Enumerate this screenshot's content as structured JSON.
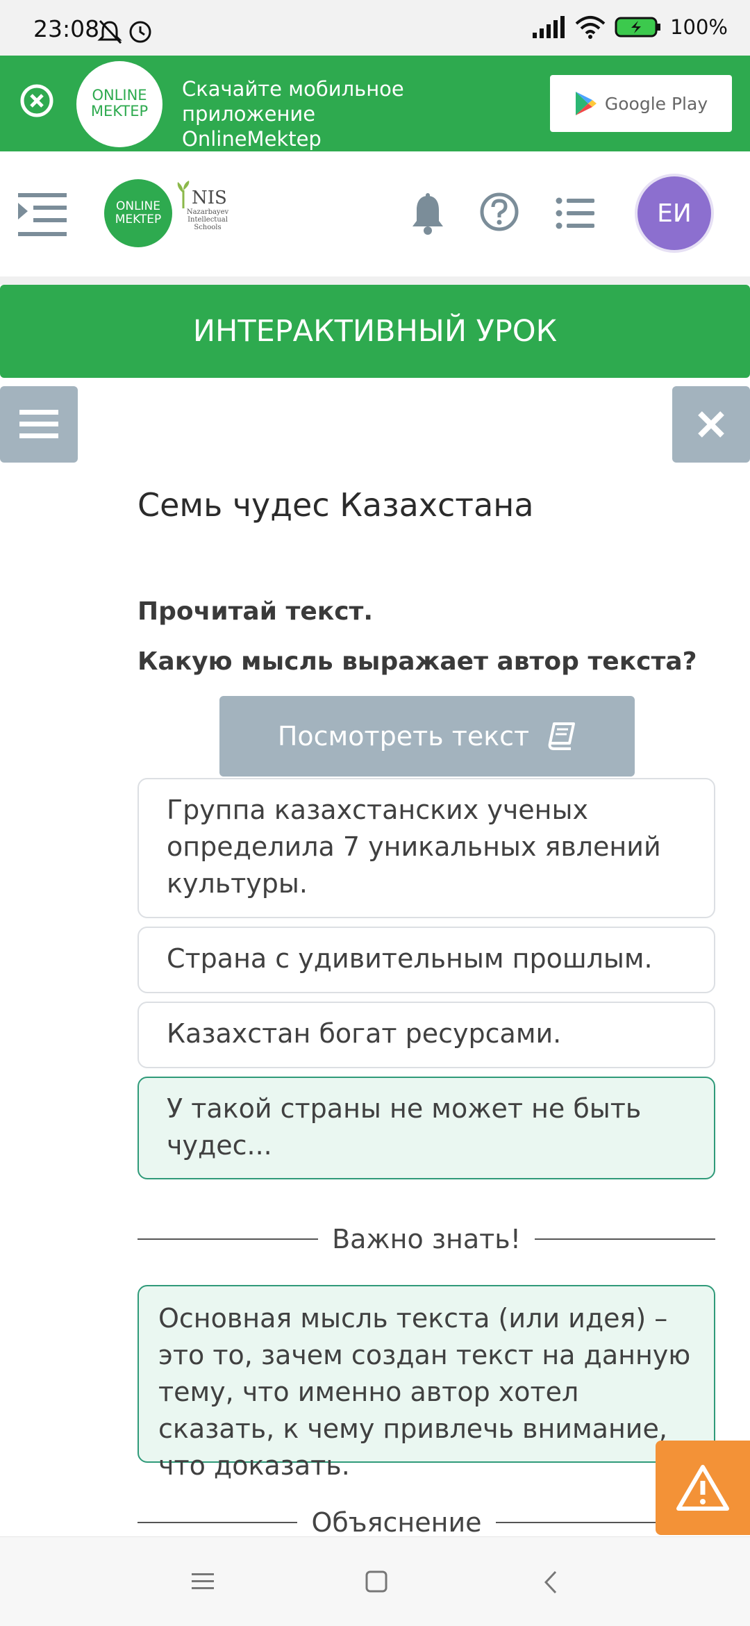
{
  "status": {
    "time": "23:08",
    "battery": "100%"
  },
  "promo": {
    "logo_line1": "ONLINE",
    "logo_line2": "MEKTEP",
    "text_line1": "Скачайте мобильное приложение",
    "text_line2": "OnlineMektep",
    "store_button": "Google Play"
  },
  "header": {
    "logo_line1": "ONLINE",
    "logo_line2": "MEKTEP",
    "nis_title": "NIS",
    "nis_sub1": "Nazarbayev",
    "nis_sub2": "Intellectual",
    "nis_sub3": "Schools",
    "avatar_initials": "ЕИ"
  },
  "lesson": {
    "bar_label": "ИНТЕРАКТИВНЫЙ УРОК",
    "title": "Семь чудес Казахстана",
    "instruction1": "Прочитай текст.",
    "instruction2": "Какую мысль выражает автор текста?",
    "view_text_button": "Посмотреть текст",
    "options": [
      {
        "text": "Группа казахстанских ученых определила 7 уникальных явлений культуры.",
        "state": "default"
      },
      {
        "text": "Страна с удивительным прошлым.",
        "state": "default"
      },
      {
        "text": "Казахстан богат ресурсами.",
        "state": "default"
      },
      {
        "text": "У такой страны не может не быть чудес...",
        "state": "correct"
      }
    ],
    "important_label": "Важно знать!",
    "note_text": "Основная мысль текста (или идея) – это то, зачем создан текст на данную тему, что именно автор хотел сказать, к чему привлечь внимание, что доказать.",
    "explanation_label": "Объяснение"
  },
  "colors": {
    "brand_green": "#2eaa4f",
    "correct_border": "#2f9a79",
    "correct_bg": "#eaf7f1",
    "muted_button": "#a3b3be",
    "warning": "#f39237",
    "avatar": "#8c6fcf"
  },
  "icons": [
    "bell-off-icon",
    "alarm-icon",
    "signal-icon",
    "wifi-icon",
    "battery-icon",
    "close-circle-icon",
    "google-play-icon",
    "menu-indent-icon",
    "bell-icon",
    "help-icon",
    "list-icon",
    "hamburger-icon",
    "close-icon",
    "book-icon",
    "warning-icon",
    "recents-icon",
    "home-icon",
    "back-icon"
  ]
}
